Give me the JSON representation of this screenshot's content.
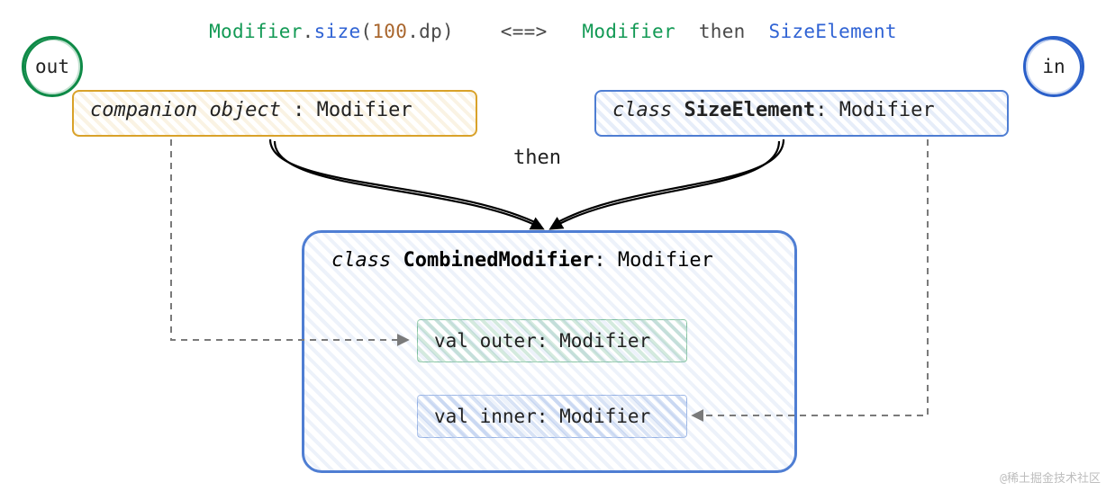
{
  "top": {
    "modifier": "Modifier",
    "dot": ".",
    "size": "size",
    "paren_open": "(",
    "hundred": "100",
    "dp": ".dp",
    "paren_close": ")",
    "equiv": "<==>",
    "modifier2": "Modifier",
    "then": "then",
    "size_elem": "SizeElement"
  },
  "bubbles": {
    "out": "out",
    "in": "in"
  },
  "box_orange": {
    "companion": "companion object",
    "colon": " : ",
    "type": "Modifier"
  },
  "box_blue_sm": {
    "kw": "class ",
    "name": "SizeElement",
    "colon": ": ",
    "type": "Modifier"
  },
  "then_label": "then",
  "combined": {
    "kw": "class ",
    "name": "CombinedModifier",
    "colon": ": ",
    "type": "Modifier",
    "outer": "val outer: Modifier",
    "inner": "val inner: Modifier"
  },
  "watermark": "@稀土掘金技术社区"
}
